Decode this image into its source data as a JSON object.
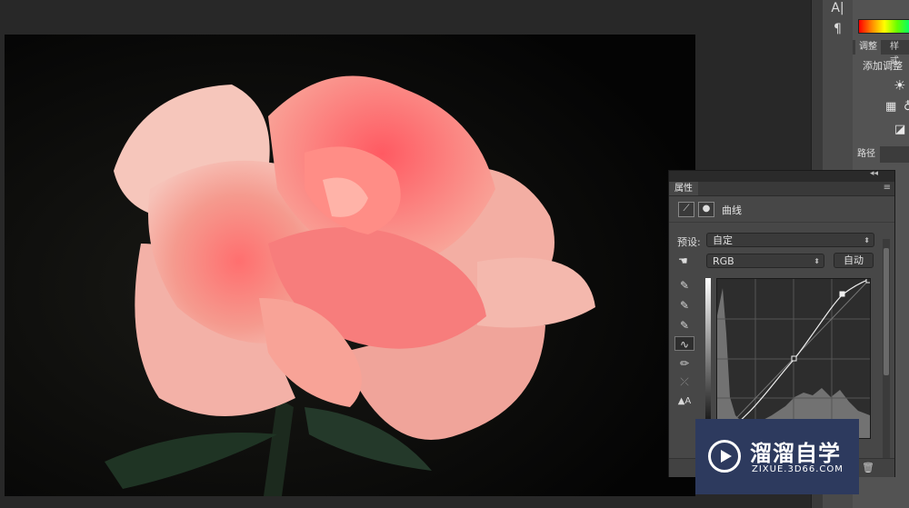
{
  "right_strip": {
    "char_icon": "A|",
    "paragraph_icon": "¶"
  },
  "right_panel": {
    "tabs": [
      "调整",
      "样式"
    ],
    "add_adjustment_label": "添加调整",
    "paths_tab": "路径",
    "icons": [
      "brightness-icon",
      "levels-icon",
      "curves-adjust-icon",
      "exposure-icon"
    ]
  },
  "properties": {
    "collapse_label": "◂◂",
    "tab_label": "属性",
    "menu_icon": "≡",
    "adjustment_name": "曲线",
    "preset_label": "预设:",
    "preset_value": "自定",
    "channel_value": "RGB",
    "auto_button": "自动",
    "tools": [
      "sample-white-icon",
      "sample-gray-icon",
      "sample-black-icon",
      "curve-edit-icon",
      "pencil-icon",
      "smooth-icon",
      "clipping-warning-icon"
    ]
  },
  "watermark": {
    "title": "溜溜自学",
    "url": "ZIXUE.3D66.COM"
  },
  "colors": {
    "canvas_bg": "#060606",
    "panel_bg": "#474747",
    "watermark_bg": "#2d3a5e"
  }
}
